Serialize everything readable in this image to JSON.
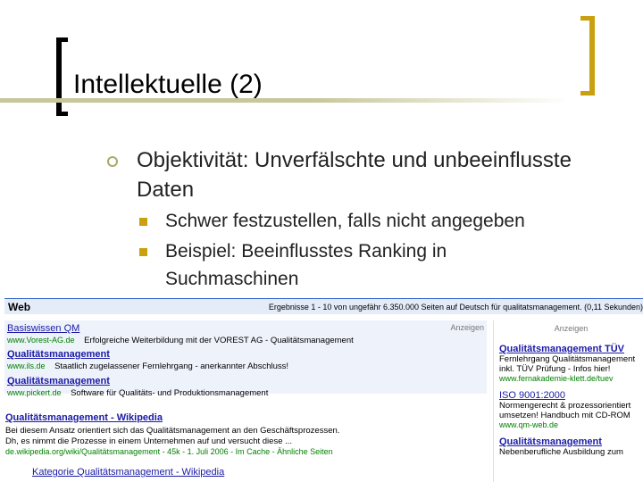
{
  "slide": {
    "title": "Intellektuelle (2)",
    "bullet": "Objektivität: Unverfälschte und unbeeinflusste Daten",
    "subbullets": [
      "Schwer festzustellen, falls nicht angegeben",
      "Beispiel: Beeinflusstes Ranking in Suchmaschinen"
    ]
  },
  "search": {
    "web_label": "Web",
    "results_info": "Ergebnisse 1 - 10 von ungefähr 6.350.000 Seiten auf Deutsch für qualitatsmanagement. (0,11 Sekunden)",
    "ads_label": "Anzeigen",
    "top_ads": [
      {
        "title": "Basiswissen QM",
        "url": "www.Vorest-AG.de",
        "desc": "Erfolgreiche Weiterbildung mit der VOREST AG - Qualitätsmanagement"
      },
      {
        "title": "Qualitätsmanagement",
        "url": "www.ils.de",
        "desc": "Staatlich zugelassener Fernlehrgang - anerkannter Abschluss!"
      },
      {
        "title": "Qualitätsmanagement",
        "url": "www.pickert.de",
        "desc": "Software für Qualitäts- und Produktionsmanagement"
      }
    ],
    "results": [
      {
        "title": "Qualitätsmanagement - Wikipedia",
        "snippet1": "Bei diesem Ansatz orientiert sich das Qualitätsmanagement an den Geschäftsprozessen.",
        "snippet2": "Dh, es nimmt die Prozesse in einem Unternehmen auf und versucht diese ...",
        "meta": "de.wikipedia.org/wiki/Qualitätsmanagement - 45k - 1. Juli 2006 - Im Cache - Ähnliche Seiten"
      },
      {
        "title": "Kategorie Qualitätsmanagement - Wikipedia"
      }
    ],
    "side_label": "Anzeigen",
    "side_ads": [
      {
        "title": "Qualitätsmanagement TÜV",
        "l1": "Fernlehrgang Qualitätsmanagement",
        "l2": "inkl. TÜV Prüfung - Infos hier!",
        "url": "www.fernakademie-klett.de/tuev"
      },
      {
        "title": "ISO 9001:2000",
        "l1": "Normengerecht & prozessorientiert",
        "l2": "umsetzen! Handbuch mit CD-ROM",
        "url": "www.qm-web.de"
      },
      {
        "title": "Qualitätsmanagement",
        "l1": "Nebenberufliche Ausbildung zum"
      }
    ]
  }
}
